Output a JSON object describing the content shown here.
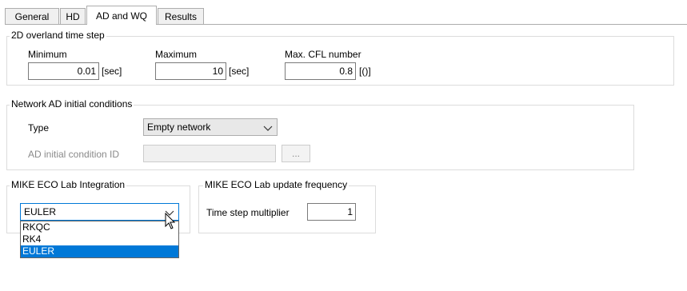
{
  "tabs": [
    {
      "label": "General"
    },
    {
      "label": "HD"
    },
    {
      "label": "AD and WQ",
      "active": true
    },
    {
      "label": "Results"
    }
  ],
  "overland": {
    "legend": "2D overland time step",
    "minimum_label": "Minimum",
    "minimum_value": "0.01",
    "minimum_unit": "[sec]",
    "maximum_label": "Maximum",
    "maximum_value": "10",
    "maximum_unit": "[sec]",
    "cfl_label": "Max. CFL number",
    "cfl_value": "0.8",
    "cfl_unit": "[()]"
  },
  "network": {
    "legend": "Network AD initial conditions",
    "type_label": "Type",
    "type_value": "Empty network",
    "id_label": "AD initial condition ID",
    "id_value": "",
    "browse_label": "..."
  },
  "ecolab": {
    "legend": "MIKE ECO Lab Integration",
    "selected": "EULER",
    "options": [
      "RKQC",
      "RK4",
      "EULER"
    ],
    "selected_index": 2
  },
  "update": {
    "legend": "MIKE ECO Lab update frequency",
    "multiplier_label": "Time step multiplier",
    "multiplier_value": "1"
  },
  "colors": {
    "selection": "#0078d7",
    "focus_border": "#0078d7",
    "disabled_text": "#8a8a8a"
  }
}
